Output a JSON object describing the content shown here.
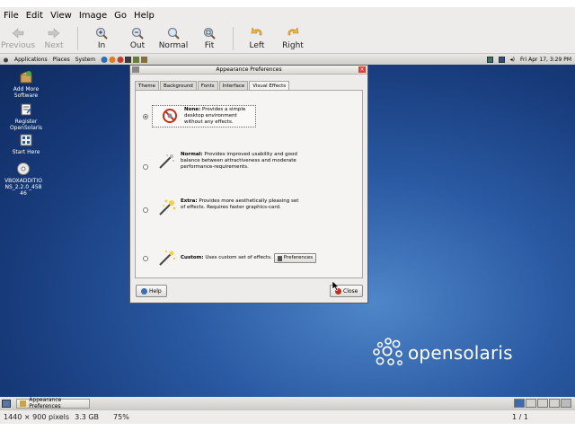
{
  "viewer": {
    "menu": [
      "File",
      "Edit",
      "View",
      "Image",
      "Go",
      "Help"
    ],
    "toolbar": {
      "previous": "Previous",
      "next": "Next",
      "zoom_in": "In",
      "zoom_out": "Out",
      "normal": "Normal",
      "fit": "Fit",
      "rotate_left": "Left",
      "rotate_right": "Right"
    },
    "status": {
      "dimensions": "1440 × 900 pixels",
      "size": "3.3 GB",
      "zoom": "75%",
      "position": "1 / 1"
    }
  },
  "desktop": {
    "top_panel": {
      "applications": "Applications",
      "places": "Places",
      "system": "System",
      "clock": "Fri Apr 17,  3:29 PM"
    },
    "icons": [
      {
        "label": "Add More Software"
      },
      {
        "label": "Register OpenSolaris"
      },
      {
        "label": "Start Here"
      },
      {
        "label": "VBOXADDITIONS_2.2.0_45846"
      }
    ],
    "logo_text": "opensolaris",
    "taskbar": {
      "window_button": "Appearance Preferences"
    }
  },
  "dialog": {
    "title": "Appearance Preferences",
    "tabs": [
      "Theme",
      "Background",
      "Fonts",
      "Interface",
      "Visual Effects"
    ],
    "active_tab": "Visual Effects",
    "options": [
      {
        "name": "None:",
        "desc": "Provides a simple desktop environment without any effects.",
        "checked": true
      },
      {
        "name": "Normal:",
        "desc": "Provides improved usability and good balance between attractiveness and moderate performance-requirements.",
        "checked": false
      },
      {
        "name": "Extra:",
        "desc": "Provides more aesthetically pleasing set of effects. Requires faster graphics-card.",
        "checked": false
      },
      {
        "name": "Custom:",
        "desc": "Uses custom set of effects.",
        "checked": false
      }
    ],
    "preferences_button": "Preferences",
    "help_button": "Help",
    "close_button": "Close"
  }
}
